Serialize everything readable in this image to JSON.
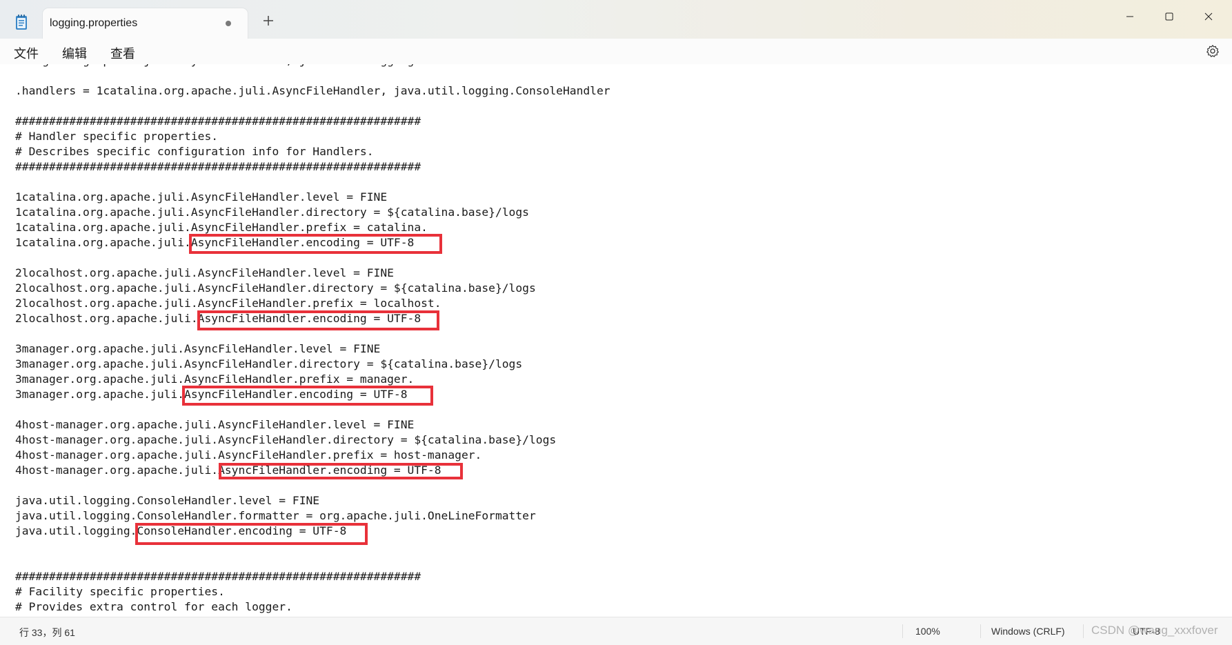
{
  "window": {
    "tab_title": "logging.properties",
    "tab_modified_indicator": "●",
    "new_tab_symbol": "+"
  },
  "menu": {
    "file": "文件",
    "edit": "编辑",
    "view": "查看"
  },
  "editor": {
    "lines": [
      "manager.org.apache.juli.AsyncFileHandler, java.util.logging.ConsoleHandler",
      "",
      ".handlers = 1catalina.org.apache.juli.AsyncFileHandler, java.util.logging.ConsoleHandler",
      "",
      "############################################################",
      "# Handler specific properties.",
      "# Describes specific configuration info for Handlers.",
      "############################################################",
      "",
      "1catalina.org.apache.juli.AsyncFileHandler.level = FINE",
      "1catalina.org.apache.juli.AsyncFileHandler.directory = ${catalina.base}/logs",
      "1catalina.org.apache.juli.AsyncFileHandler.prefix = catalina.",
      "1catalina.org.apache.juli.AsyncFileHandler.encoding = UTF-8",
      "",
      "2localhost.org.apache.juli.AsyncFileHandler.level = FINE",
      "2localhost.org.apache.juli.AsyncFileHandler.directory = ${catalina.base}/logs",
      "2localhost.org.apache.juli.AsyncFileHandler.prefix = localhost.",
      "2localhost.org.apache.juli.AsyncFileHandler.encoding = UTF-8",
      "",
      "3manager.org.apache.juli.AsyncFileHandler.level = FINE",
      "3manager.org.apache.juli.AsyncFileHandler.directory = ${catalina.base}/logs",
      "3manager.org.apache.juli.AsyncFileHandler.prefix = manager.",
      "3manager.org.apache.juli.AsyncFileHandler.encoding = UTF-8",
      "",
      "4host-manager.org.apache.juli.AsyncFileHandler.level = FINE",
      "4host-manager.org.apache.juli.AsyncFileHandler.directory = ${catalina.base}/logs",
      "4host-manager.org.apache.juli.AsyncFileHandler.prefix = host-manager.",
      "4host-manager.org.apache.juli.AsyncFileHandler.encoding = UTF-8",
      "",
      "java.util.logging.ConsoleHandler.level = FINE",
      "java.util.logging.ConsoleHandler.formatter = org.apache.juli.OneLineFormatter",
      "java.util.logging.ConsoleHandler.encoding = UTF-8",
      "",
      "",
      "############################################################",
      "# Facility specific properties.",
      "# Provides extra control for each logger."
    ],
    "highlight_color": "#e8313a"
  },
  "status": {
    "position": "行 33，列 61",
    "zoom": "100%",
    "line_ending": "Windows (CRLF)",
    "encoding": "UTF-8",
    "watermark": "CSDN @wang_xxxfover"
  }
}
